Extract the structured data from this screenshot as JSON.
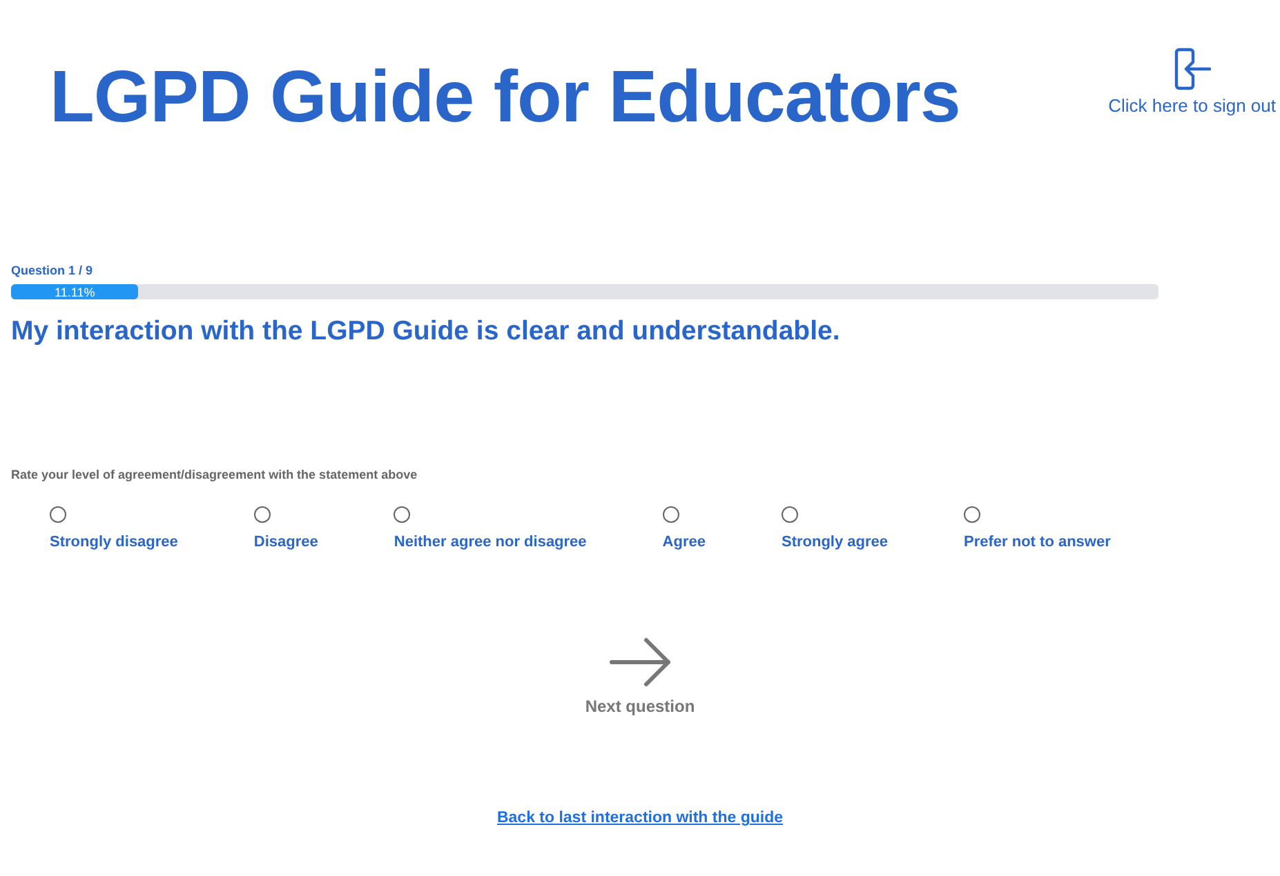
{
  "header": {
    "title": "LGPD Guide for Educators",
    "sign_out": "Click here to sign out"
  },
  "progress": {
    "label": "Question 1 / 9",
    "level": 0.1111,
    "reading": "11.11%"
  },
  "question": "My interaction with the LGPD Guide is clear and understandable.",
  "instruction": "Rate your level of agreement/disagreement with the statement above",
  "options": [
    {
      "label": "Strongly disagree",
      "selected": false
    },
    {
      "label": "Disagree",
      "selected": false
    },
    {
      "label": "Neither agree nor disagree",
      "selected": false
    },
    {
      "label": "Agree",
      "selected": false
    },
    {
      "label": "Strongly agree",
      "selected": false
    },
    {
      "label": "Prefer not to answer",
      "selected": false
    }
  ],
  "next": {
    "label": "Next question"
  },
  "back_link": "Back to last interaction with the guide"
}
